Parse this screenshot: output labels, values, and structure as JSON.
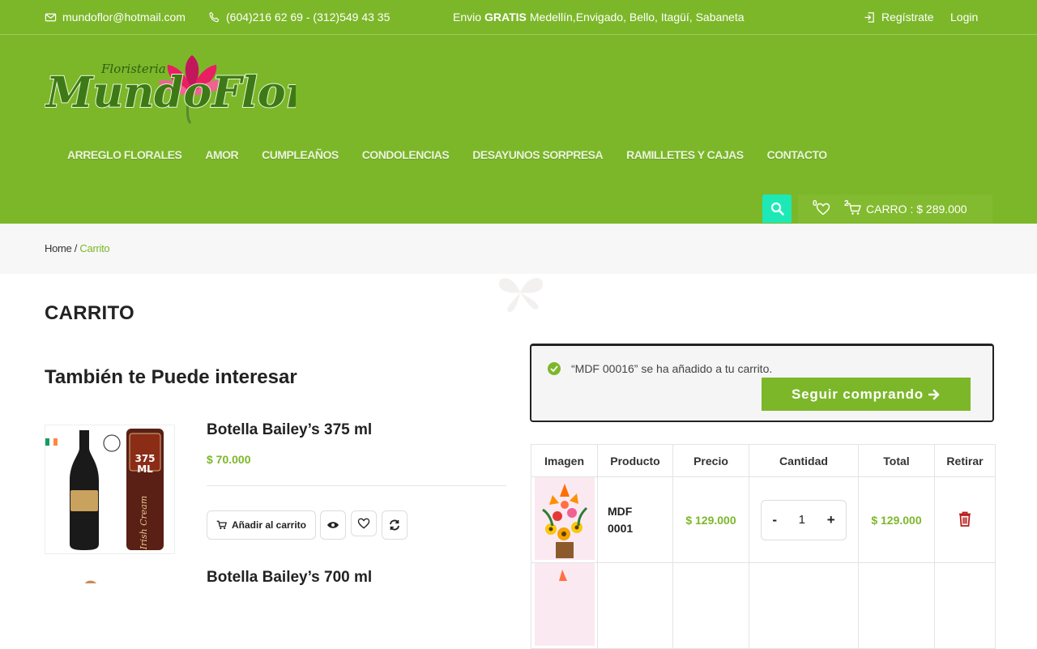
{
  "topbar": {
    "email": "mundoflor@hotmail.com",
    "phones": "(604)216 62 69 - (312)549 43 35",
    "shipping_prefix": "Envio",
    "shipping_bold": "GRATIS",
    "shipping_cities": "Medellín,Envigado, Bello, Itagüí, Sabaneta",
    "register": "Regístrate",
    "login": "Login"
  },
  "logo": {
    "small": "Floristeria",
    "main": "MundoFlor"
  },
  "nav": [
    "ARREGLO FLORALES",
    "AMOR",
    "CUMPLEAÑOS",
    "CONDOLENCIAS",
    "DESAYUNOS SORPRESA",
    "RAMILLETES Y CAJAS",
    "CONTACTO"
  ],
  "header_tools": {
    "wishlist_count": "0",
    "cart_count": "2",
    "cart_label": "CARRO : $ 289.000"
  },
  "breadcrumb": {
    "home": "Home",
    "separator": " / ",
    "current": "Carrito"
  },
  "page_title": "CARRITO",
  "related": {
    "title": "También te Puede interesar",
    "add_to_cart": "Añadir al carrito",
    "products": [
      {
        "name": "Botella Bailey’s 375 ml",
        "price": "$ 70.000",
        "label_size": "375",
        "label_unit": "ML",
        "label_script": "Irish Cream"
      },
      {
        "name": "Botella Bailey’s 700 ml"
      }
    ]
  },
  "notice": {
    "message": "“MDF 00016” se ha añadido a tu carrito.",
    "button": "Seguir comprando"
  },
  "cart_table": {
    "headers": [
      "Imagen",
      "Producto",
      "Precio",
      "Cantidad",
      "Total",
      "Retirar"
    ],
    "rows": [
      {
        "product_line1": "MDF",
        "product_line2": "0001",
        "price": "$ 129.000",
        "qty_minus": "-",
        "qty": "1",
        "qty_plus": "+",
        "total": "$ 129.000"
      }
    ]
  },
  "colors": {
    "brand_green": "#7cb72a",
    "search_accent": "#1de9b6",
    "delete_red": "#b71c1c"
  }
}
